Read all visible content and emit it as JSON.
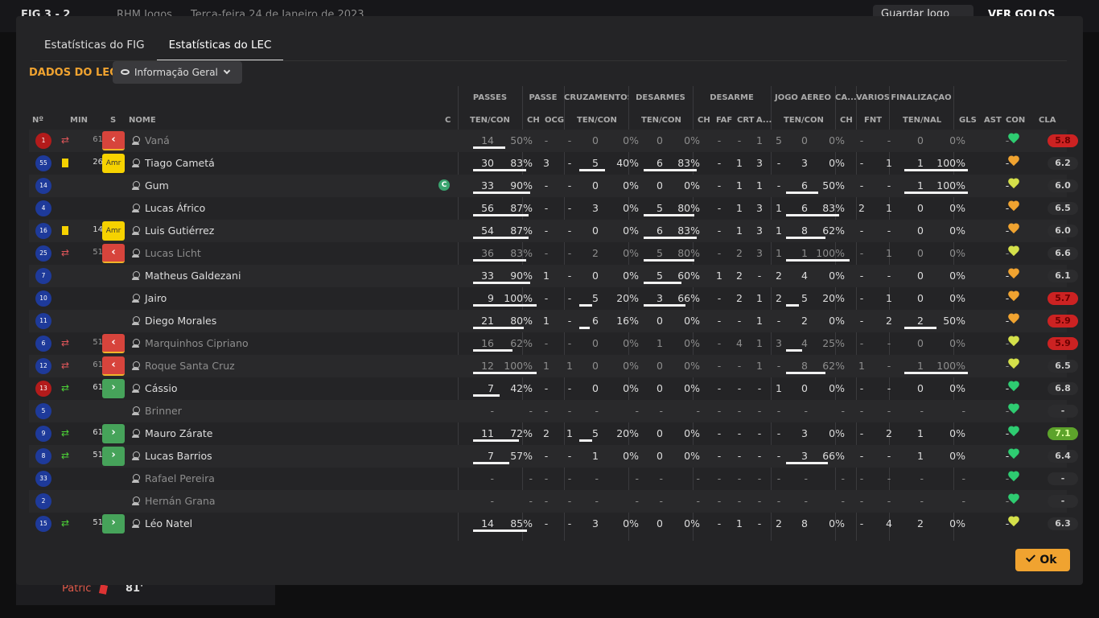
{
  "background": {
    "score": "FIG   3 - 2",
    "competition": "RHM Jogos",
    "date": "Terça-feira 24 de Janeiro de 2023",
    "save_label": "Guardar Jogo",
    "goals_label": "VER GOLOS",
    "bottom_player": "Patric",
    "bottom_minute": "81'"
  },
  "modal": {
    "tabs": [
      "Estatísticas do FIG",
      "Estatísticas do LEC"
    ],
    "active_tab": 1,
    "section_title": "DADOS DO LEC",
    "dropdown_label": "Informação Geral",
    "ok_label": "Ok"
  },
  "table": {
    "groups": [
      "PASSES",
      "PASSE",
      "CRUZAMENTOS",
      "DESARMES",
      "DESARME",
      "JOGO AÉREO",
      "CA...",
      "VÁRIOS",
      "FINALIZAÇÃO"
    ],
    "headers": {
      "num": "Nº",
      "min": "MIN",
      "s": "S",
      "name": "NOME",
      "c": "C",
      "passes": "TEN/CON",
      "passe_ch": "CH",
      "passe_ocg": "OCG",
      "cruz": "TEN/CON",
      "desarmes": "TEN/CON",
      "des_ch": "CH",
      "des_faf": "FAF",
      "des_crt": "CRT",
      "des_a": "A...",
      "aereo": "TEN/CON",
      "ca_ch": "CH",
      "var_fnt": "FNT",
      "fin": "TEN/NAL",
      "gls": "GLS",
      "ast": "AST",
      "con": "CON",
      "cla": "CLA"
    },
    "rows": [
      {
        "num": "1",
        "gk": true,
        "event": "out",
        "min": "61",
        "badge": "out",
        "name": "Vaná",
        "cap": "",
        "dim": true,
        "p": [
          "14",
          "50%",
          0.5
        ],
        "pch": "-",
        "ocg": "-",
        "cr": [
          "0",
          "0%",
          0
        ],
        "de": [
          "0",
          "0%",
          0
        ],
        "dch": "-",
        "faf": "-",
        "crt": "1",
        "da": "5",
        "ae": [
          "0",
          "0%",
          0
        ],
        "cach": "-",
        "fnt": "-",
        "fi": [
          "0",
          "0%",
          0
        ],
        "gls": "",
        "ast": "-",
        "con": "g",
        "cla": "5.8",
        "claColor": "red"
      },
      {
        "num": "55",
        "gk": false,
        "event": "yellow",
        "min": "26",
        "badge": "amr",
        "name": "Tiago Cametá",
        "cap": "",
        "dim": false,
        "p": [
          "30",
          "83%",
          0.83
        ],
        "pch": "3",
        "ocg": "-",
        "cr": [
          "5",
          "40%",
          0.4
        ],
        "de": [
          "6",
          "83%",
          0.83
        ],
        "dch": "-",
        "faf": "1",
        "crt": "3",
        "da": "-",
        "ae": [
          "3",
          "0%",
          0
        ],
        "cach": "-",
        "fnt": "1",
        "fi": [
          "1",
          "100%",
          1
        ],
        "gls": "",
        "ast": "-",
        "con": "o",
        "cla": "6.2",
        "claColor": ""
      },
      {
        "num": "14",
        "gk": false,
        "event": "",
        "min": "",
        "badge": "",
        "name": "Gum",
        "cap": "C",
        "dim": false,
        "p": [
          "33",
          "90%",
          0.9
        ],
        "pch": "-",
        "ocg": "-",
        "cr": [
          "0",
          "0%",
          0
        ],
        "de": [
          "0",
          "0%",
          0
        ],
        "dch": "-",
        "faf": "1",
        "crt": "1",
        "da": "-",
        "ae": [
          "6",
          "50%",
          0.5
        ],
        "cach": "-",
        "fnt": "-",
        "fi": [
          "1",
          "100%",
          1
        ],
        "gls": "",
        "ast": "-",
        "con": "y",
        "cla": "6.0",
        "claColor": ""
      },
      {
        "num": "4",
        "gk": false,
        "event": "",
        "min": "",
        "badge": "",
        "name": "Lucas Áfrico",
        "cap": "",
        "dim": false,
        "p": [
          "56",
          "87%",
          0.87
        ],
        "pch": "-",
        "ocg": "-",
        "cr": [
          "3",
          "0%",
          0
        ],
        "de": [
          "5",
          "80%",
          0.8
        ],
        "dch": "-",
        "faf": "1",
        "crt": "3",
        "da": "1",
        "ae": [
          "6",
          "83%",
          0.83
        ],
        "cach": "2",
        "fnt": "1",
        "fi": [
          "0",
          "0%",
          0
        ],
        "gls": "",
        "ast": "-",
        "con": "o",
        "cla": "6.5",
        "claColor": ""
      },
      {
        "num": "16",
        "gk": false,
        "event": "yellow",
        "min": "14",
        "badge": "amr",
        "name": "Luis Gutiérrez",
        "cap": "",
        "dim": false,
        "p": [
          "54",
          "87%",
          0.87
        ],
        "pch": "-",
        "ocg": "-",
        "cr": [
          "0",
          "0%",
          0
        ],
        "de": [
          "6",
          "83%",
          0.83
        ],
        "dch": "-",
        "faf": "1",
        "crt": "3",
        "da": "1",
        "ae": [
          "8",
          "62%",
          0.62
        ],
        "cach": "-",
        "fnt": "-",
        "fi": [
          "0",
          "0%",
          0
        ],
        "gls": "",
        "ast": "-",
        "con": "o",
        "cla": "6.0",
        "claColor": ""
      },
      {
        "num": "25",
        "gk": false,
        "event": "out",
        "min": "51",
        "badge": "out",
        "name": "Lucas Licht",
        "cap": "",
        "dim": true,
        "p": [
          "36",
          "83%",
          0.83
        ],
        "pch": "-",
        "ocg": "-",
        "cr": [
          "2",
          "0%",
          0
        ],
        "de": [
          "5",
          "80%",
          0.8
        ],
        "dch": "-",
        "faf": "2",
        "crt": "3",
        "da": "1",
        "ae": [
          "1",
          "100%",
          1
        ],
        "cach": "-",
        "fnt": "1",
        "fi": [
          "0",
          "0%",
          0
        ],
        "gls": "",
        "ast": "-",
        "con": "y",
        "cla": "6.6",
        "claColor": ""
      },
      {
        "num": "7",
        "gk": false,
        "event": "",
        "min": "",
        "badge": "",
        "name": "Matheus Galdezani",
        "cap": "",
        "dim": false,
        "p": [
          "33",
          "90%",
          0.9
        ],
        "pch": "1",
        "ocg": "-",
        "cr": [
          "0",
          "0%",
          0
        ],
        "de": [
          "5",
          "60%",
          0.6
        ],
        "dch": "1",
        "faf": "2",
        "crt": "-",
        "da": "2",
        "ae": [
          "4",
          "0%",
          0
        ],
        "cach": "-",
        "fnt": "-",
        "fi": [
          "0",
          "0%",
          0
        ],
        "gls": "",
        "ast": "-",
        "con": "o",
        "cla": "6.1",
        "claColor": ""
      },
      {
        "num": "10",
        "gk": false,
        "event": "",
        "min": "",
        "badge": "",
        "name": "Jairo",
        "cap": "",
        "dim": false,
        "p": [
          "9",
          "100%",
          1
        ],
        "pch": "-",
        "ocg": "-",
        "cr": [
          "5",
          "20%",
          0.2
        ],
        "de": [
          "3",
          "66%",
          0.66
        ],
        "dch": "-",
        "faf": "2",
        "crt": "1",
        "da": "2",
        "ae": [
          "5",
          "20%",
          0.2
        ],
        "cach": "-",
        "fnt": "1",
        "fi": [
          "0",
          "0%",
          0
        ],
        "gls": "",
        "ast": "-",
        "con": "o",
        "cla": "5.7",
        "claColor": "red"
      },
      {
        "num": "11",
        "gk": false,
        "event": "",
        "min": "",
        "badge": "",
        "name": "Diego Morales",
        "cap": "",
        "dim": false,
        "p": [
          "21",
          "80%",
          0.8
        ],
        "pch": "1",
        "ocg": "-",
        "cr": [
          "6",
          "16%",
          0.16
        ],
        "de": [
          "0",
          "0%",
          0
        ],
        "dch": "-",
        "faf": "-",
        "crt": "1",
        "da": "-",
        "ae": [
          "2",
          "0%",
          0
        ],
        "cach": "-",
        "fnt": "2",
        "fi": [
          "2",
          "50%",
          0.5
        ],
        "gls": "",
        "ast": "-",
        "con": "o",
        "cla": "5.9",
        "claColor": "red"
      },
      {
        "num": "6",
        "gk": false,
        "event": "out",
        "min": "51",
        "badge": "out",
        "name": "Marquinhos Cipriano",
        "cap": "",
        "dim": true,
        "p": [
          "16",
          "62%",
          0.62
        ],
        "pch": "-",
        "ocg": "-",
        "cr": [
          "0",
          "0%",
          0
        ],
        "de": [
          "1",
          "0%",
          0
        ],
        "dch": "-",
        "faf": "4",
        "crt": "1",
        "da": "3",
        "ae": [
          "4",
          "25%",
          0.25
        ],
        "cach": "-",
        "fnt": "-",
        "fi": [
          "0",
          "0%",
          0
        ],
        "gls": "",
        "ast": "-",
        "con": "y",
        "cla": "5.9",
        "claColor": "red"
      },
      {
        "num": "12",
        "gk": false,
        "event": "out",
        "min": "61",
        "badge": "out",
        "name": "Roque Santa Cruz",
        "cap": "",
        "dim": true,
        "p": [
          "12",
          "100%",
          1
        ],
        "pch": "1",
        "ocg": "1",
        "cr": [
          "0",
          "0%",
          0
        ],
        "de": [
          "0",
          "0%",
          0
        ],
        "dch": "-",
        "faf": "-",
        "crt": "1",
        "da": "-",
        "ae": [
          "8",
          "62%",
          0.62
        ],
        "cach": "1",
        "fnt": "-",
        "fi": [
          "1",
          "100%",
          1
        ],
        "gls": "",
        "ast": "-",
        "con": "y",
        "cla": "6.5",
        "claColor": ""
      },
      {
        "num": "13",
        "gk": true,
        "event": "in",
        "min": "61",
        "badge": "in",
        "name": "Cássio",
        "cap": "",
        "dim": false,
        "p": [
          "7",
          "42%",
          0.42
        ],
        "pch": "-",
        "ocg": "-",
        "cr": [
          "0",
          "0%",
          0
        ],
        "de": [
          "0",
          "0%",
          0
        ],
        "dch": "-",
        "faf": "-",
        "crt": "-",
        "da": "1",
        "ae": [
          "0",
          "0%",
          0
        ],
        "cach": "-",
        "fnt": "-",
        "fi": [
          "0",
          "0%",
          0
        ],
        "gls": "",
        "ast": "-",
        "con": "g",
        "cla": "6.8",
        "claColor": ""
      },
      {
        "num": "5",
        "gk": false,
        "event": "",
        "min": "",
        "badge": "",
        "name": "Brinner",
        "cap": "",
        "dim": true,
        "p": [
          "-",
          "-",
          0
        ],
        "pch": "-",
        "ocg": "-",
        "cr": [
          "-",
          "-",
          0
        ],
        "de": [
          "-",
          "-",
          0
        ],
        "dch": "-",
        "faf": "-",
        "crt": "-",
        "da": "-",
        "ae": [
          "-",
          "-",
          0
        ],
        "cach": "-",
        "fnt": "-",
        "fi": [
          "-",
          "-",
          0
        ],
        "gls": "",
        "ast": "-",
        "con": "g",
        "cla": "-",
        "claColor": ""
      },
      {
        "num": "9",
        "gk": false,
        "event": "in",
        "min": "61",
        "badge": "in",
        "name": "Mauro Zárate",
        "cap": "",
        "dim": false,
        "p": [
          "11",
          "72%",
          0.72
        ],
        "pch": "2",
        "ocg": "1",
        "cr": [
          "5",
          "20%",
          0.2
        ],
        "de": [
          "0",
          "0%",
          0
        ],
        "dch": "-",
        "faf": "-",
        "crt": "-",
        "da": "-",
        "ae": [
          "3",
          "0%",
          0
        ],
        "cach": "-",
        "fnt": "2",
        "fi": [
          "1",
          "0%",
          0
        ],
        "gls": "",
        "ast": "-",
        "con": "g",
        "cla": "7.1",
        "claColor": "green"
      },
      {
        "num": "8",
        "gk": false,
        "event": "in",
        "min": "51",
        "badge": "in",
        "name": "Lucas Barrios",
        "cap": "",
        "dim": false,
        "p": [
          "7",
          "57%",
          0.57
        ],
        "pch": "-",
        "ocg": "-",
        "cr": [
          "1",
          "0%",
          0
        ],
        "de": [
          "0",
          "0%",
          0
        ],
        "dch": "-",
        "faf": "-",
        "crt": "-",
        "da": "-",
        "ae": [
          "3",
          "66%",
          0.66
        ],
        "cach": "-",
        "fnt": "-",
        "fi": [
          "1",
          "0%",
          0
        ],
        "gls": "",
        "ast": "-",
        "con": "g",
        "cla": "6.4",
        "claColor": ""
      },
      {
        "num": "33",
        "gk": false,
        "event": "",
        "min": "",
        "badge": "",
        "name": "Rafael Pereira",
        "cap": "",
        "dim": true,
        "p": [
          "-",
          "-",
          0
        ],
        "pch": "-",
        "ocg": "-",
        "cr": [
          "-",
          "-",
          0
        ],
        "de": [
          "-",
          "-",
          0
        ],
        "dch": "-",
        "faf": "-",
        "crt": "-",
        "da": "-",
        "ae": [
          "-",
          "-",
          0
        ],
        "cach": "-",
        "fnt": "-",
        "fi": [
          "-",
          "-",
          0
        ],
        "gls": "",
        "ast": "-",
        "con": "g",
        "cla": "-",
        "claColor": ""
      },
      {
        "num": "2",
        "gk": false,
        "event": "",
        "min": "",
        "badge": "",
        "name": "Hernán Grana",
        "cap": "",
        "dim": true,
        "p": [
          "-",
          "-",
          0
        ],
        "pch": "-",
        "ocg": "-",
        "cr": [
          "-",
          "-",
          0
        ],
        "de": [
          "-",
          "-",
          0
        ],
        "dch": "-",
        "faf": "-",
        "crt": "-",
        "da": "-",
        "ae": [
          "-",
          "-",
          0
        ],
        "cach": "-",
        "fnt": "-",
        "fi": [
          "-",
          "-",
          0
        ],
        "gls": "",
        "ast": "-",
        "con": "g",
        "cla": "-",
        "claColor": ""
      },
      {
        "num": "15",
        "gk": false,
        "event": "in",
        "min": "51",
        "badge": "in",
        "name": "Léo Natel",
        "cap": "",
        "dim": false,
        "p": [
          "14",
          "85%",
          0.85
        ],
        "pch": "-",
        "ocg": "-",
        "cr": [
          "3",
          "0%",
          0
        ],
        "de": [
          "0",
          "0%",
          0
        ],
        "dch": "-",
        "faf": "1",
        "crt": "-",
        "da": "2",
        "ae": [
          "8",
          "0%",
          0
        ],
        "cach": "-",
        "fnt": "4",
        "fi": [
          "2",
          "0%",
          0
        ],
        "gls": "",
        "ast": "-",
        "con": "y",
        "cla": "6.3",
        "claColor": ""
      }
    ]
  }
}
